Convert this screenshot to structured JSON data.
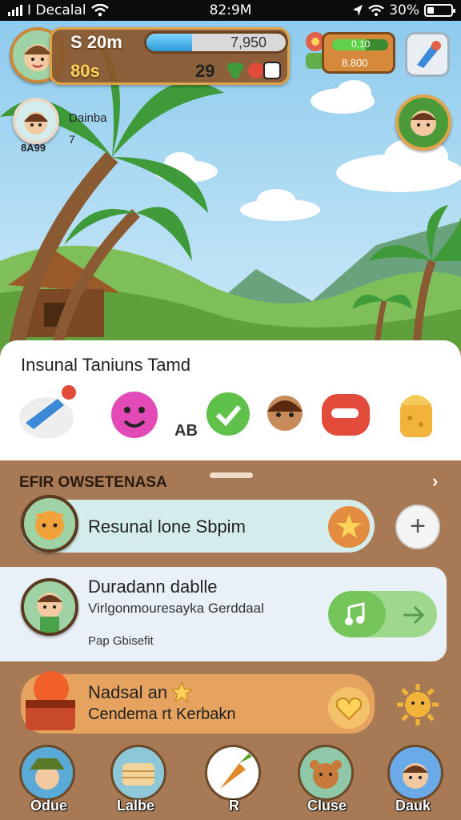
{
  "status": {
    "carrier": "I Decalal",
    "time": "82:9M",
    "battery": "30%",
    "battery_level": 0.3
  },
  "hud": {
    "score": "S 20m",
    "progress_value": "7,950",
    "progress": 0.33,
    "sub_value": "80s",
    "gems": "29",
    "panel_value_top": "0,10",
    "panel_value_bottom": "8.800",
    "panel_progress": 0.6,
    "player_name": "Dainba",
    "player_level": "7",
    "player_coins": "8A99"
  },
  "card": {
    "title": "Insunal Taniuns Tamd",
    "tag": "AB"
  },
  "sheet": {
    "title": "EFIR OWSETENASA",
    "close_icon": "chevron-right-icon",
    "row1": {
      "text": "Resunal lone Sbpim"
    },
    "row2": {
      "title": "Duradann dablle",
      "subtitle": "Virlgonmouresayka Gerddaal",
      "footer": "Pap Gbisefit"
    },
    "row3": {
      "title": "Nadsal an",
      "subtitle": "Cendema rt Kerbakn"
    }
  },
  "nav": [
    {
      "label": "Odue",
      "icon": "farmer-avatar-icon"
    },
    {
      "label": "Lalbe",
      "icon": "bread-icon"
    },
    {
      "label": "R",
      "icon": "carrot-icon"
    },
    {
      "label": "Cluse",
      "icon": "bear-avatar-icon"
    },
    {
      "label": "Dauk",
      "icon": "boy-avatar-icon"
    }
  ],
  "colors": {
    "sky": "#8ecbee",
    "sheet": "#a77a55",
    "accent": "#e2a44a",
    "progress": "#2b9ad8"
  }
}
